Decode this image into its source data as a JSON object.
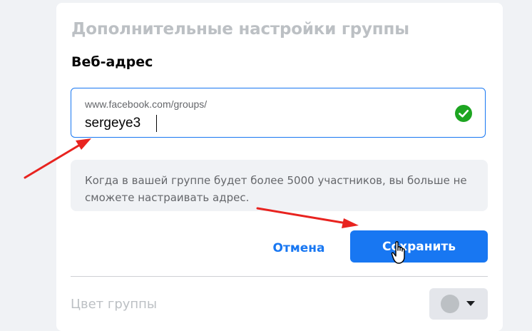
{
  "dialog": {
    "section_title": "Дополнительные настройки группы",
    "field_title": "Веб-адрес"
  },
  "url_field": {
    "prefix": "www.facebook.com/groups/",
    "value": "sergeye3",
    "valid_icon": "check-circle-icon"
  },
  "info": {
    "text": "Когда в вашей группе будет более 5000 участников, вы больше не сможете настраивать адрес."
  },
  "actions": {
    "cancel_label": "Отмена",
    "save_label": "Сохранить"
  },
  "color_setting": {
    "label": "Цвет группы",
    "swatch_color": "#bcc0c4",
    "dropdown_icon": "chevron-down-icon"
  },
  "annotations": {
    "arrow_color": "#e8231f",
    "cursor_icon": "hand-pointer-icon"
  },
  "colors": {
    "accent": "#1877f2",
    "success": "#1da521"
  }
}
